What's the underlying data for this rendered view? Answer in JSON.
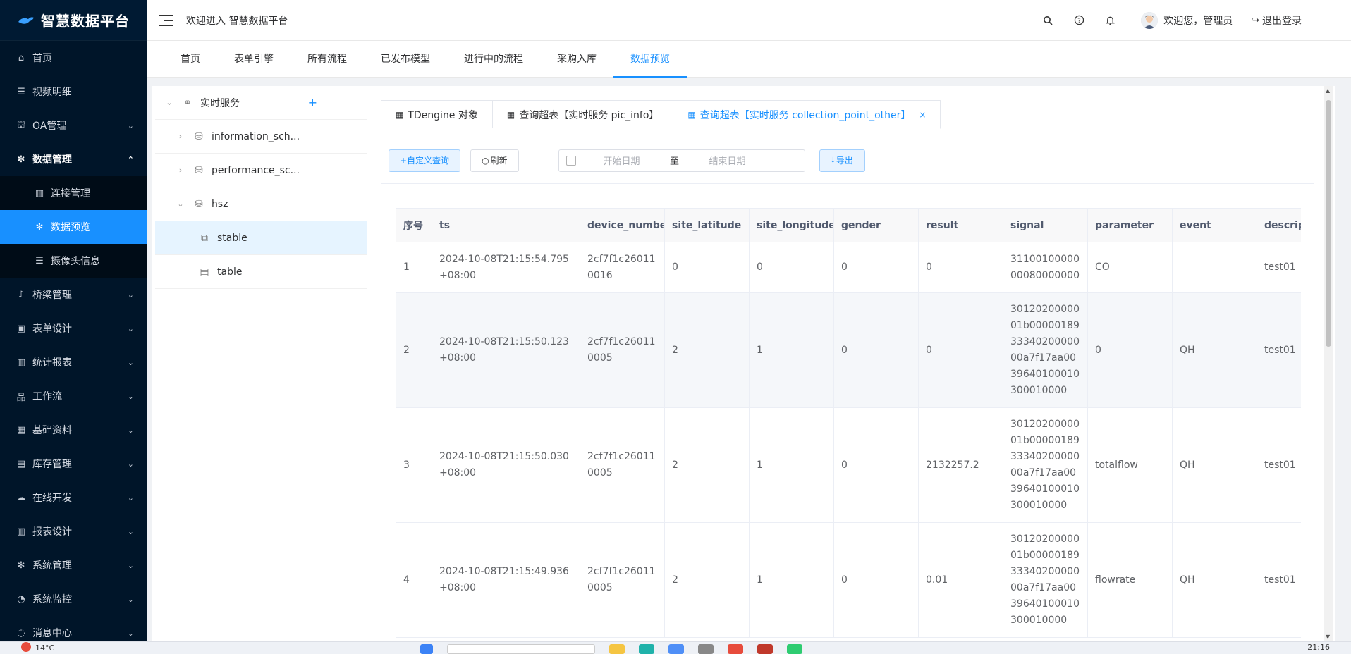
{
  "app": {
    "title": "智慧数据平台"
  },
  "sidebar": {
    "items": [
      {
        "label": "首页",
        "icon": "home-icon"
      },
      {
        "label": "视频明细",
        "icon": "list-icon"
      },
      {
        "label": "OA管理",
        "icon": "user-icon"
      },
      {
        "label": "数据管理",
        "icon": "gear-icon",
        "open": true
      },
      {
        "label": "连接管理",
        "icon": "chart-icon"
      },
      {
        "label": "数据预览",
        "icon": "gear-icon",
        "active": true
      },
      {
        "label": "摄像头信息",
        "icon": "list-icon"
      },
      {
        "label": "桥梁管理",
        "icon": "bell-icon"
      },
      {
        "label": "表单设计",
        "icon": "form-icon"
      },
      {
        "label": "统计报表",
        "icon": "chart-icon"
      },
      {
        "label": "工作流",
        "icon": "tree-icon"
      },
      {
        "label": "基础资料",
        "icon": "grid-icon"
      },
      {
        "label": "库存管理",
        "icon": "doc-icon"
      },
      {
        "label": "在线开发",
        "icon": "cloud-icon"
      },
      {
        "label": "报表设计",
        "icon": "chart-icon"
      },
      {
        "label": "系统管理",
        "icon": "gear-icon"
      },
      {
        "label": "系统监控",
        "icon": "dashboard-icon"
      },
      {
        "label": "消息中心",
        "icon": "message-icon"
      }
    ]
  },
  "header": {
    "welcome": "欢迎进入 智慧数据平台",
    "user": "欢迎您，管理员",
    "logout": "退出登录"
  },
  "top_tabs": [
    "首页",
    "表单引擎",
    "所有流程",
    "已发布模型",
    "进行中的流程",
    "采购入库",
    "数据预览"
  ],
  "tree": {
    "root": "实时服务",
    "nodes": [
      "information_sch...",
      "performance_sc...",
      "hsz",
      "stable",
      "table"
    ]
  },
  "panel_tabs": [
    "TDengine 对象",
    "查询超表【实时服务 pic_info】",
    "查询超表【实时服务 collection_point_other】"
  ],
  "toolbar": {
    "custom_query": "+自定义查询",
    "refresh": "刷新",
    "start_placeholder": "开始日期",
    "range_sep": "至",
    "end_placeholder": "结束日期",
    "export": "导出"
  },
  "table": {
    "columns": [
      "序号",
      "ts",
      "device_number",
      "site_latitude",
      "site_longitude",
      "gender",
      "result",
      "signal",
      "parameter",
      "event",
      "descript"
    ],
    "rows": [
      [
        "1",
        "2024-10-08T21:15:54.795+08:00",
        "2cf7f1c260110016",
        "0",
        "0",
        "0",
        "0",
        "3110010000000080000000",
        "CO",
        "",
        "test01"
      ],
      [
        "2",
        "2024-10-08T21:15:50.123+08:00",
        "2cf7f1c260110005",
        "2",
        "1",
        "0",
        "0",
        "3012020000001b000001893334020000000a7f17aa0039640100010300010000",
        "0",
        "QH",
        "test01"
      ],
      [
        "3",
        "2024-10-08T21:15:50.030+08:00",
        "2cf7f1c260110005",
        "2",
        "1",
        "0",
        "2132257.2",
        "3012020000001b000001893334020000000a7f17aa0039640100010300010000",
        "totalflow",
        "QH",
        "test01"
      ],
      [
        "4",
        "2024-10-08T21:15:49.936+08:00",
        "2cf7f1c260110005",
        "2",
        "1",
        "0",
        "0.01",
        "3012020000001b000001893334020000000a7f17aa0039640100010300010000",
        "flowrate",
        "QH",
        "test01"
      ]
    ]
  },
  "taskbar": {
    "weather": "14°C",
    "time": "21:16"
  }
}
